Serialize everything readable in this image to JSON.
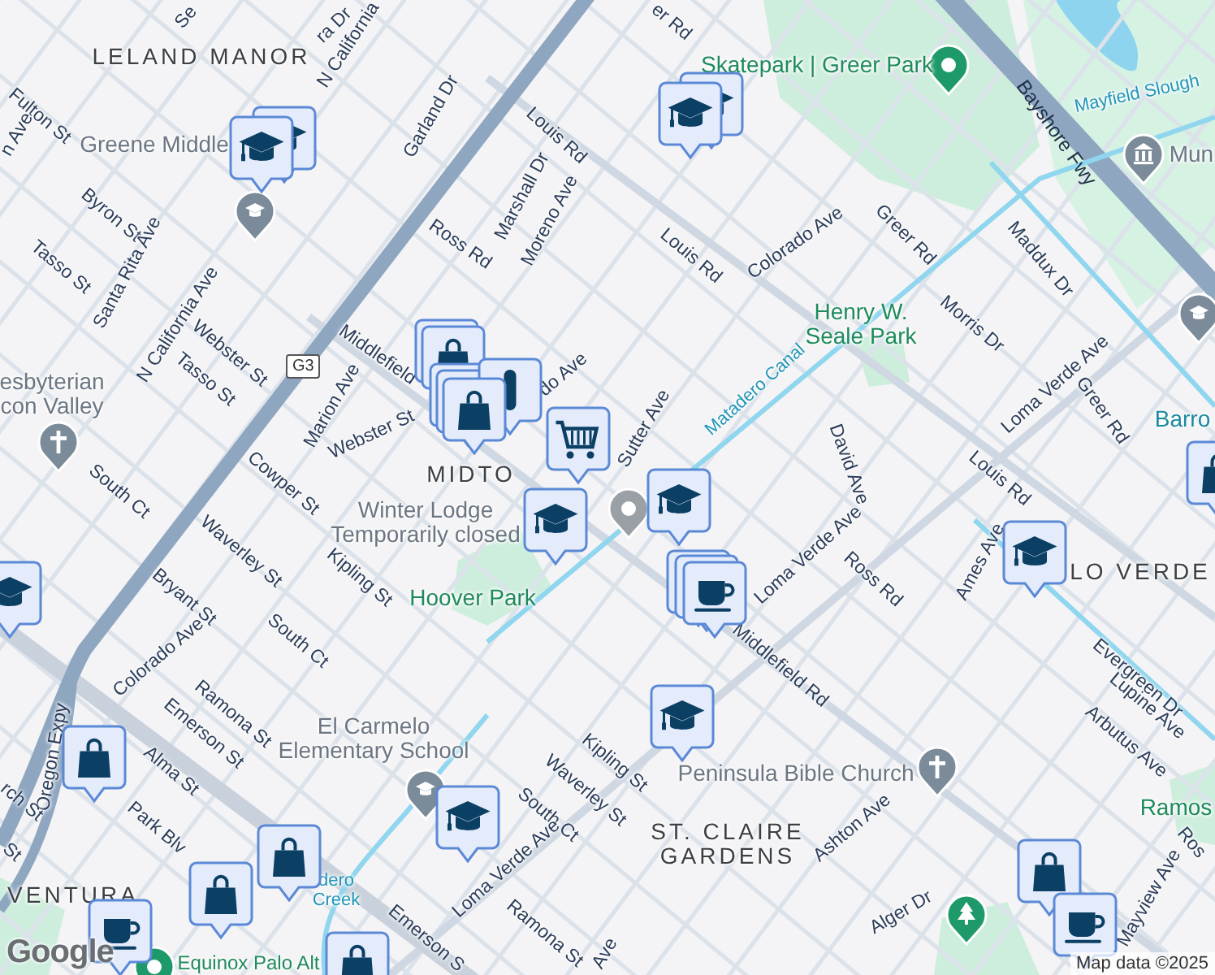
{
  "map": {
    "labels": [
      {
        "text": "Se",
        "kind": "street"
      },
      {
        "text": "ra Dr",
        "kind": "street"
      },
      {
        "text": "er Rd",
        "kind": "street"
      },
      {
        "text": "LELAND MANOR",
        "kind": "neighborhood"
      },
      {
        "text": "Skatepark | Greer Park",
        "kind": "park"
      },
      {
        "text": "N California",
        "kind": "street"
      },
      {
        "text": "Mayfield Slough",
        "kind": "water"
      },
      {
        "text": "Fulton St",
        "kind": "street"
      },
      {
        "text": "n Ave",
        "kind": "street"
      },
      {
        "text": "Garland Dr",
        "kind": "street"
      },
      {
        "text": "Louis Rd",
        "kind": "street"
      },
      {
        "text": "Bayshore Fwy",
        "kind": "highway"
      },
      {
        "text": "Greene Middle",
        "kind": "poi"
      },
      {
        "text": "Muni",
        "kind": "poi"
      },
      {
        "text": "Marshall Dr",
        "kind": "street"
      },
      {
        "text": "Moreno Ave",
        "kind": "street"
      },
      {
        "text": "Byron St",
        "kind": "street"
      },
      {
        "text": "Louis Rd",
        "kind": "street"
      },
      {
        "text": "Colorado Ave",
        "kind": "street"
      },
      {
        "text": "Greer Rd",
        "kind": "street"
      },
      {
        "text": "Maddux Dr",
        "kind": "street"
      },
      {
        "text": "Ross Rd",
        "kind": "street"
      },
      {
        "text": "Tasso St",
        "kind": "street"
      },
      {
        "text": "Santa Rita Ave",
        "kind": "street"
      },
      {
        "text": "N California Ave",
        "kind": "street"
      },
      {
        "lines": [
          "Henry W.",
          "Seale Park"
        ],
        "kind": "park"
      },
      {
        "text": "Morris Dr",
        "kind": "street"
      },
      {
        "text": "Webster St",
        "kind": "street"
      },
      {
        "text": "Middlefield",
        "kind": "street"
      },
      {
        "text": "Tasso St",
        "kind": "street"
      },
      {
        "text": "Loma Verde Ave",
        "kind": "street"
      },
      {
        "text": "do Ave",
        "kind": "street"
      },
      {
        "text": "Matadero Canal",
        "kind": "water"
      },
      {
        "lines": [
          "esbyterian",
          "con Valley"
        ],
        "kind": "poi"
      },
      {
        "text": "Marion Ave",
        "kind": "street"
      },
      {
        "text": "Greer Rd",
        "kind": "street"
      },
      {
        "text": "Barro",
        "kind": "teal"
      },
      {
        "text": "Webster St",
        "kind": "street"
      },
      {
        "text": "Sutter Ave",
        "kind": "street"
      },
      {
        "text": "MIDTO",
        "kind": "neighborhood"
      },
      {
        "text": "David Ave",
        "kind": "street"
      },
      {
        "text": "Louis Rd",
        "kind": "street"
      },
      {
        "text": "Cowper St",
        "kind": "street"
      },
      {
        "text": "South Ct",
        "kind": "street"
      },
      {
        "lines": [
          "Winter Lodge",
          "Temporarily closed"
        ],
        "kind": "poi"
      },
      {
        "text": "Ames Ave",
        "kind": "street"
      },
      {
        "text": "Loma Verde Ave",
        "kind": "street"
      },
      {
        "text": "Ross Rd",
        "kind": "street"
      },
      {
        "text": "LO VERDE",
        "kind": "neighborhood"
      },
      {
        "text": "Waverley St",
        "kind": "street"
      },
      {
        "text": "Kipling St",
        "kind": "street"
      },
      {
        "text": "Hoover Park",
        "kind": "park"
      },
      {
        "text": "Bryant St",
        "kind": "street"
      },
      {
        "text": "South Ct",
        "kind": "street"
      },
      {
        "text": "Colorado Ave",
        "kind": "street"
      },
      {
        "text": "Middlefield Rd",
        "kind": "street"
      },
      {
        "text": "Evergreen Dr",
        "kind": "street"
      },
      {
        "text": "Lupine Ave",
        "kind": "street"
      },
      {
        "text": "Ramona St",
        "kind": "street"
      },
      {
        "text": "Emerson St",
        "kind": "street"
      },
      {
        "lines": [
          "El Carmelo",
          "Elementary School"
        ],
        "kind": "poi"
      },
      {
        "text": "Arbutus Ave",
        "kind": "street"
      },
      {
        "text": "Oregon Expy",
        "kind": "street"
      },
      {
        "text": "Kipling St",
        "kind": "street"
      },
      {
        "text": "Alma St",
        "kind": "street"
      },
      {
        "text": "Peninsula Bible Church",
        "kind": "poi"
      },
      {
        "text": "rch St",
        "kind": "street"
      },
      {
        "text": "Waverley St",
        "kind": "street"
      },
      {
        "text": "Ramos",
        "kind": "park"
      },
      {
        "text": "South Ct",
        "kind": "street"
      },
      {
        "text": "Park Blv",
        "kind": "street"
      },
      {
        "text": "Ashton Ave",
        "kind": "street"
      },
      {
        "text": "Ros",
        "kind": "street"
      },
      {
        "lines": [
          "ST. CLAIRE",
          "GARDENS"
        ],
        "kind": "neighborhood"
      },
      {
        "text": "St",
        "kind": "street"
      },
      {
        "lines": [
          "dero",
          "Creek"
        ],
        "kind": "water"
      },
      {
        "text": "Loma Verde Ave",
        "kind": "street"
      },
      {
        "text": "VENTURA",
        "kind": "neighborhood"
      },
      {
        "text": "Alger Dr",
        "kind": "street"
      },
      {
        "text": "Mayview Ave",
        "kind": "street"
      },
      {
        "text": "Ramona St",
        "kind": "street"
      },
      {
        "text": "Emerson S",
        "kind": "street"
      },
      {
        "text": "Ave",
        "kind": "street"
      },
      {
        "text": "Equinox Palo Alt",
        "kind": "park"
      }
    ],
    "route_shield": "G3",
    "pins": [
      {
        "kind": "school",
        "color": "#7b8b99"
      },
      {
        "kind": "place",
        "color": "#1e9a6a"
      },
      {
        "kind": "building",
        "color": "#7b8b99"
      },
      {
        "kind": "school",
        "color": "#7b8b99"
      },
      {
        "kind": "church",
        "color": "#7b8b99"
      },
      {
        "kind": "place",
        "color": "#9aa0a6"
      },
      {
        "kind": "school",
        "color": "#7b8b99"
      },
      {
        "kind": "church",
        "color": "#7b8b99"
      },
      {
        "kind": "tree",
        "color": "#1e9a6a"
      },
      {
        "kind": "place",
        "color": "#1e9a6a"
      }
    ],
    "markers": [
      {
        "kind": "school"
      },
      {
        "kind": "school"
      },
      {
        "kind": "school"
      },
      {
        "kind": "school"
      },
      {
        "kind": "shop"
      },
      {
        "kind": "shop"
      },
      {
        "kind": "shop"
      },
      {
        "kind": "shop"
      },
      {
        "kind": "drink"
      },
      {
        "kind": "shop"
      },
      {
        "kind": "cart"
      },
      {
        "kind": "school"
      },
      {
        "kind": "school"
      },
      {
        "kind": "cafe"
      },
      {
        "kind": "cafe"
      },
      {
        "kind": "cafe"
      },
      {
        "kind": "school"
      },
      {
        "kind": "shop"
      },
      {
        "kind": "school"
      },
      {
        "kind": "shop"
      },
      {
        "kind": "shop"
      },
      {
        "kind": "shop"
      },
      {
        "kind": "cafe"
      },
      {
        "kind": "shop"
      },
      {
        "kind": "school"
      },
      {
        "kind": "shop"
      },
      {
        "kind": "cafe"
      },
      {
        "kind": "school"
      }
    ]
  },
  "logo": "Google",
  "attribution": "Map data ©2025"
}
